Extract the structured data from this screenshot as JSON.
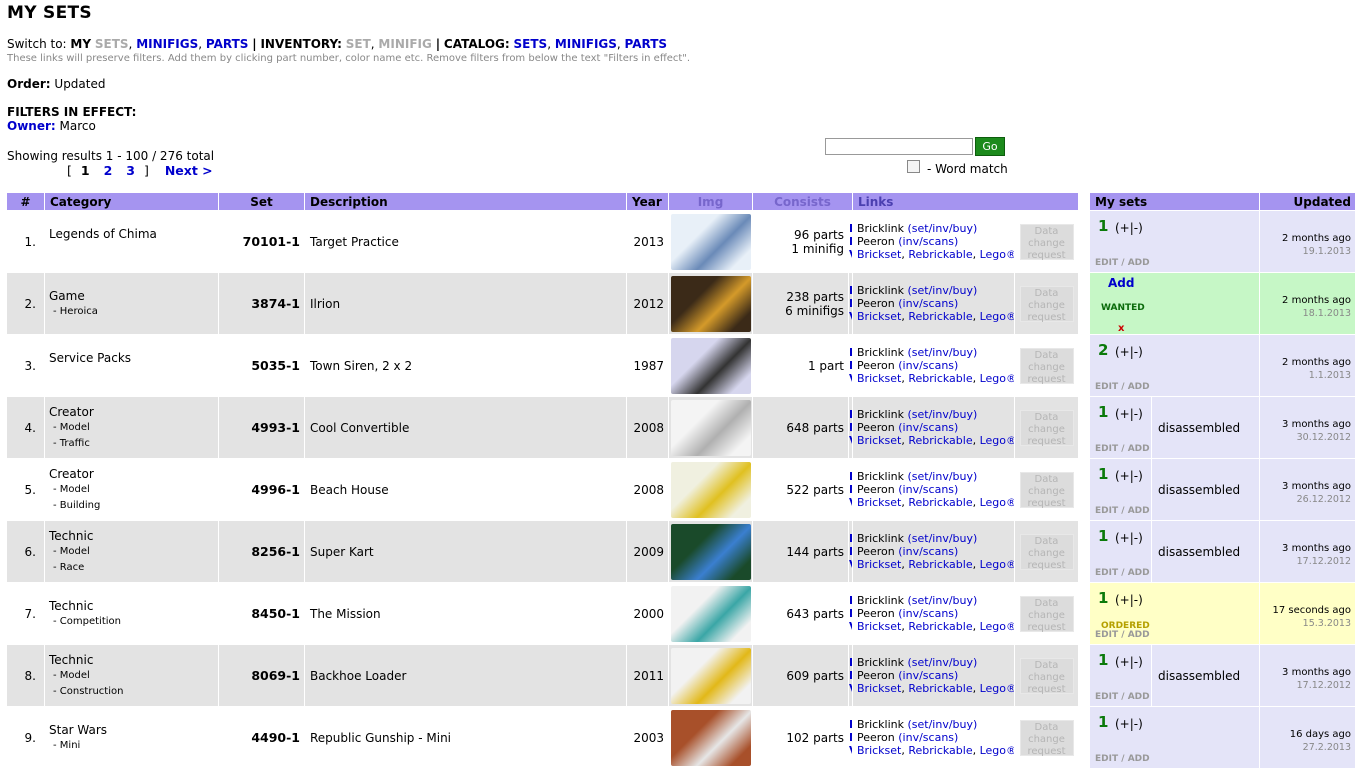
{
  "page_title": "MY SETS",
  "switch": {
    "prefix": "Switch to:",
    "my_label": "MY",
    "my_sets": "SETS",
    "my_minifigs": "MINIFIGS",
    "my_parts": "PARTS",
    "inventory_label": "INVENTORY:",
    "inv_set": "SET",
    "inv_minifig": "MINIFIG",
    "catalog_label": "CATALOG:",
    "cat_sets": "SETS",
    "cat_minifigs": "MINIFIGS",
    "cat_parts": "PARTS",
    "hint": "These links will preserve filters. Add them by clicking part number, color name etc. Remove filters from below the text \"Filters in effect\"."
  },
  "order": {
    "label": "Order:",
    "value": "Updated"
  },
  "filters": {
    "heading": "FILTERS IN EFFECT:",
    "owner_label": "Owner:",
    "owner_value": "Marco"
  },
  "results": {
    "text": "Showing results 1 - 100 / 276 total"
  },
  "pager": {
    "open": "[",
    "current": "1",
    "p2": "2",
    "p3": "3",
    "close": "]",
    "next": "Next >"
  },
  "search": {
    "value": "",
    "go_label": "Go",
    "word_match_label": "- Word match"
  },
  "columns": {
    "num": "#",
    "category": "Category",
    "set": "Set",
    "description": "Description",
    "year": "Year",
    "img": "Img",
    "consists": "Consists",
    "links": "Links"
  },
  "side_columns": {
    "my_sets": "My sets",
    "updated": "Updated"
  },
  "link_text": {
    "bricklink": "Bricklink",
    "bricklink_sub": "(set/inv/buy)",
    "peeron": "Peeron",
    "peeron_sub": "(inv/scans)",
    "brickset": "Brickset",
    "rebrickable": "Rebrickable",
    "lego": "Lego®",
    "inv_i": "I",
    "inv_n": "N",
    "inv_v": "V",
    "data_change": "Data change request",
    "edit": "EDIT",
    "slash": "/",
    "add": "ADD",
    "pm": "(+|-)"
  },
  "colors": {
    "header_bg": "#a594f0",
    "link": "#0000cc",
    "qty_green": "#0b7a0b",
    "wanted_bg": "#c6f7c6",
    "ordered_bg": "#ffffc6",
    "side_bg": "#e4e4f8"
  },
  "rows": [
    {
      "num": "1.",
      "category": "Legends of Chima",
      "sub1": "",
      "sub2": "",
      "set": "70101-1",
      "description": "Target Practice",
      "year": "2013",
      "img_icon": "chima-set-thumbnail",
      "cons1": "96 parts",
      "cons2": "1 minifig",
      "qty": "1",
      "status": "",
      "note": "",
      "ago": "2 months ago",
      "date": "19.1.2013"
    },
    {
      "num": "2.",
      "category": "Game",
      "sub1": "- Heroica",
      "sub2": "",
      "set": "3874-1",
      "description": "Ilrion",
      "year": "2012",
      "img_icon": "heroica-box-thumbnail",
      "cons1": "238 parts",
      "cons2": "6 minifigs",
      "qty": "",
      "status": "wanted",
      "add": "Add",
      "wanted": "WANTED",
      "x": "x",
      "note": "",
      "ago": "2 months ago",
      "date": "18.1.2013"
    },
    {
      "num": "3.",
      "category": "Service Packs",
      "sub1": "",
      "sub2": "",
      "set": "5035-1",
      "description": "Town Siren, 2 x 2",
      "year": "1987",
      "img_icon": "siren-brick-thumbnail",
      "cons1": "1 part",
      "cons2": "",
      "qty": "2",
      "status": "",
      "note": "",
      "ago": "2 months ago",
      "date": "1.1.2013"
    },
    {
      "num": "4.",
      "category": "Creator",
      "sub1": "- Model",
      "sub2": "- Traffic",
      "set": "4993-1",
      "description": "Cool Convertible",
      "year": "2008",
      "img_icon": "convertible-car-thumbnail",
      "cons1": "648 parts",
      "cons2": "",
      "qty": "1",
      "status": "",
      "note": "disassembled",
      "ago": "3 months ago",
      "date": "30.12.2012"
    },
    {
      "num": "5.",
      "category": "Creator",
      "sub1": "- Model",
      "sub2": "- Building",
      "set": "4996-1",
      "description": "Beach House",
      "year": "2008",
      "img_icon": "beach-house-thumbnail",
      "cons1": "522 parts",
      "cons2": "",
      "qty": "1",
      "status": "",
      "note": "disassembled",
      "ago": "3 months ago",
      "date": "26.12.2012"
    },
    {
      "num": "6.",
      "category": "Technic",
      "sub1": "- Model",
      "sub2": "- Race",
      "set": "8256-1",
      "description": "Super Kart",
      "year": "2009",
      "img_icon": "super-kart-box-thumbnail",
      "cons1": "144 parts",
      "cons2": "",
      "qty": "1",
      "status": "",
      "note": "disassembled",
      "ago": "3 months ago",
      "date": "17.12.2012"
    },
    {
      "num": "7.",
      "category": "Technic",
      "sub1": "- Competition",
      "sub2": "",
      "set": "8450-1",
      "description": "The Mission",
      "year": "2000",
      "img_icon": "mission-vehicle-thumbnail",
      "cons1": "643 parts",
      "cons2": "",
      "qty": "1",
      "status": "ordered",
      "ordered": "ORDERED",
      "note": "",
      "ago": "17 seconds ago",
      "date": "15.3.2013"
    },
    {
      "num": "8.",
      "category": "Technic",
      "sub1": "- Model",
      "sub2": "- Construction",
      "set": "8069-1",
      "description": "Backhoe Loader",
      "year": "2011",
      "img_icon": "backhoe-loader-thumbnail",
      "cons1": "609 parts",
      "cons2": "",
      "qty": "1",
      "status": "",
      "note": "disassembled",
      "ago": "3 months ago",
      "date": "17.12.2012"
    },
    {
      "num": "9.",
      "category": "Star Wars",
      "sub1": "- Mini",
      "sub2": "",
      "set": "4490-1",
      "description": "Republic Gunship - Mini",
      "year": "2003",
      "img_icon": "gunship-thumbnail",
      "cons1": "102 parts",
      "cons2": "",
      "qty": "1",
      "status": "",
      "note": "",
      "ago": "16 days ago",
      "date": "27.2.2013"
    }
  ]
}
